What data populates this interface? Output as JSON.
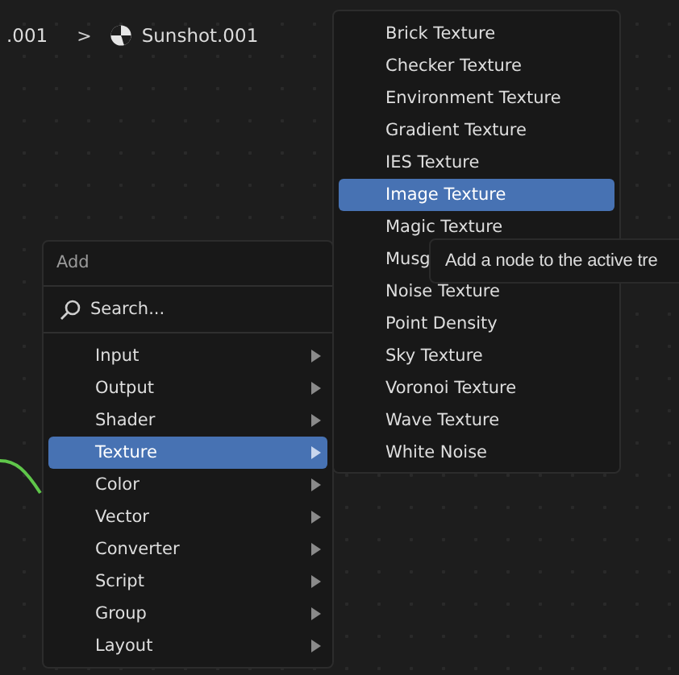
{
  "breadcrumb": [
    {
      "label": ".001"
    },
    {
      "label": "Sunshot.001"
    }
  ],
  "breadcrumb_separator": ">",
  "add_menu": {
    "title": "Add",
    "search": {
      "placeholder": "Search..."
    },
    "items": [
      {
        "label": "Input",
        "selected": false
      },
      {
        "label": "Output",
        "selected": false
      },
      {
        "label": "Shader",
        "selected": false
      },
      {
        "label": "Texture",
        "selected": true
      },
      {
        "label": "Color",
        "selected": false
      },
      {
        "label": "Vector",
        "selected": false
      },
      {
        "label": "Converter",
        "selected": false
      },
      {
        "label": "Script",
        "selected": false
      },
      {
        "label": "Group",
        "selected": false
      },
      {
        "label": "Layout",
        "selected": false
      }
    ]
  },
  "texture_menu": {
    "items": [
      {
        "label": "Brick Texture",
        "selected": false
      },
      {
        "label": "Checker Texture",
        "selected": false
      },
      {
        "label": "Environment Texture",
        "selected": false
      },
      {
        "label": "Gradient Texture",
        "selected": false
      },
      {
        "label": "IES Texture",
        "selected": false
      },
      {
        "label": "Image Texture",
        "selected": true
      },
      {
        "label": "Magic Texture",
        "selected": false
      },
      {
        "label": "Musg",
        "selected": false
      },
      {
        "label": "Noise Texture",
        "selected": false
      },
      {
        "label": "Point Density",
        "selected": false
      },
      {
        "label": "Sky Texture",
        "selected": false
      },
      {
        "label": "Voronoi Texture",
        "selected": false
      },
      {
        "label": "Wave Texture",
        "selected": false
      },
      {
        "label": "White Noise",
        "selected": false
      }
    ]
  },
  "tooltip": {
    "text": "Add a node to the active tre"
  }
}
